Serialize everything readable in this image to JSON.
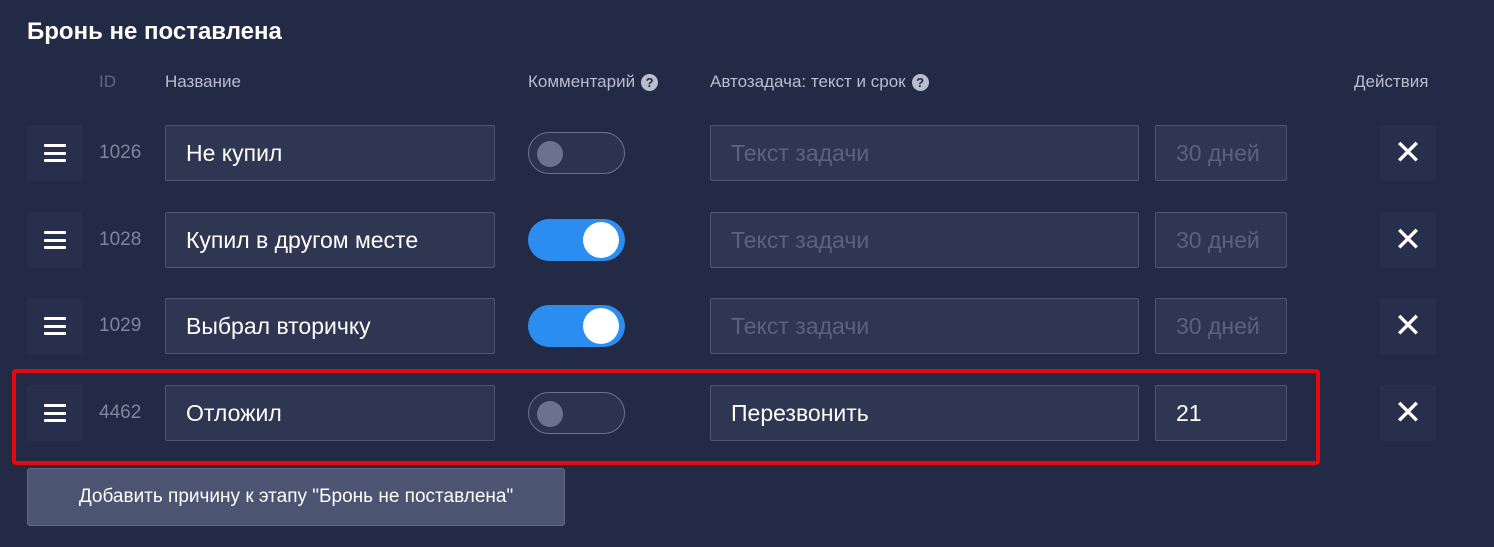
{
  "section": {
    "title": "Бронь не поставлена"
  },
  "columns": {
    "id": "ID",
    "name": "Название",
    "comment": "Комментарий",
    "autotask": "Автозадача: текст и срок",
    "actions": "Действия",
    "help_glyph": "?"
  },
  "rows": [
    {
      "id": "1026",
      "name": "Не купил",
      "comment_enabled": false,
      "task_text": "",
      "task_placeholder": "Текст задачи",
      "days": "",
      "days_placeholder": "30 дней",
      "delete_glyph": "✕"
    },
    {
      "id": "1028",
      "name": "Купил в другом месте",
      "comment_enabled": true,
      "task_text": "",
      "task_placeholder": "Текст задачи",
      "days": "",
      "days_placeholder": "30 дней",
      "delete_glyph": "✕"
    },
    {
      "id": "1029",
      "name": "Выбрал вторичку",
      "comment_enabled": true,
      "task_text": "",
      "task_placeholder": "Текст задачи",
      "days": "",
      "days_placeholder": "30 дней",
      "delete_glyph": "✕"
    },
    {
      "id": "4462",
      "name": "Отложил",
      "comment_enabled": false,
      "task_text": "Перезвонить",
      "task_placeholder": "Текст задачи",
      "days": "21",
      "days_placeholder": "30 дней",
      "delete_glyph": "✕"
    }
  ],
  "add_button": {
    "label": "Добавить причину к этапу \"Бронь не поставлена\""
  },
  "colors": {
    "background": "#222a45",
    "toggle_on": "#2c8df0",
    "highlight": "#e4080f"
  }
}
